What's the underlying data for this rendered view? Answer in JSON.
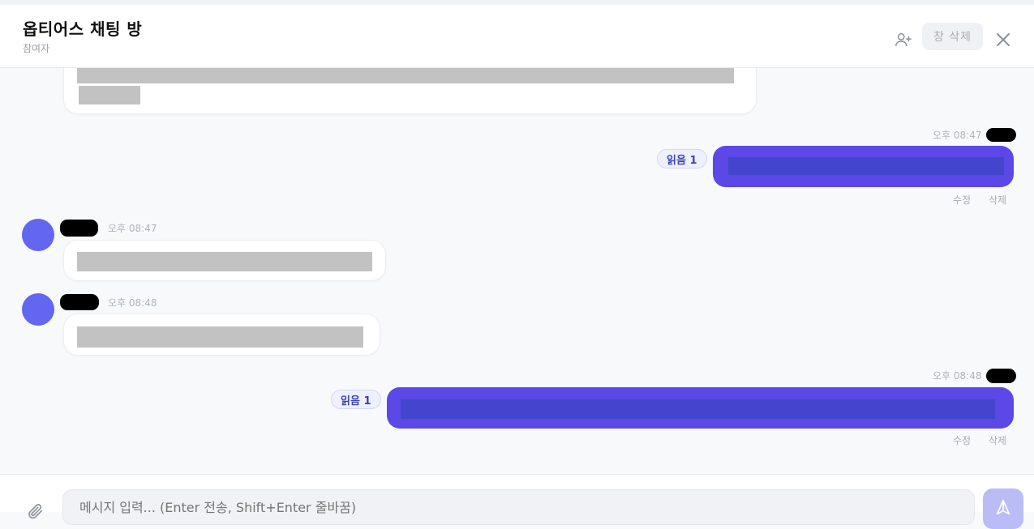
{
  "header": {
    "title": "옵티어스 채팅 방",
    "subtitle": "참여자",
    "delete_label": "창 삭제"
  },
  "messages": [
    {
      "direction": "incoming"
    },
    {
      "direction": "outgoing",
      "time": "오후 08:47",
      "read_label": "읽음 1",
      "edit_label": "수정",
      "delete_label": "삭제"
    },
    {
      "direction": "incoming",
      "time": "오후 08:47"
    },
    {
      "direction": "incoming",
      "time": "오후 08:48"
    },
    {
      "direction": "outgoing",
      "time": "오후 08:48",
      "read_label": "읽음 1",
      "edit_label": "수정",
      "delete_label": "삭제"
    }
  ],
  "composer": {
    "placeholder": "메시지 입력... (Enter 전송, Shift+Enter 줄바꿈)"
  },
  "colors": {
    "accent": "#5b48e6",
    "avatar": "#6366f1",
    "send_button": "#b9bcf6"
  },
  "icons": [
    "add-user-icon",
    "close-icon",
    "attach-icon",
    "send-icon"
  ]
}
